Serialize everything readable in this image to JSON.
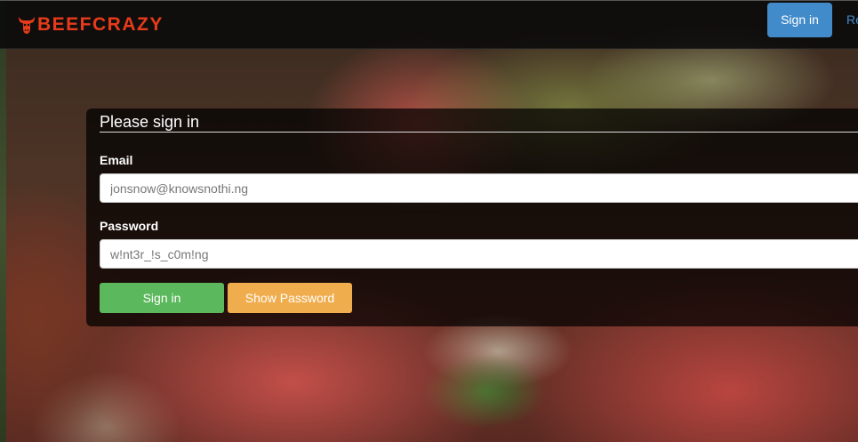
{
  "brand": {
    "name": "BEEFCRAZY",
    "color": "#e83b1a",
    "icon": "bull-head-icon"
  },
  "navbar": {
    "signin_label": "Sign in",
    "register_label": "Re"
  },
  "form": {
    "title": "Please sign in",
    "email_label": "Email",
    "email_value": "jonsnow@knowsnothi.ng",
    "password_label": "Password",
    "password_value": "w!nt3r_!s_c0m!ng",
    "signin_button": "Sign in",
    "show_password_button": "Show Password"
  },
  "colors": {
    "primary": "#428bca",
    "success": "#5cb85c",
    "warning": "#f0ad4e"
  }
}
